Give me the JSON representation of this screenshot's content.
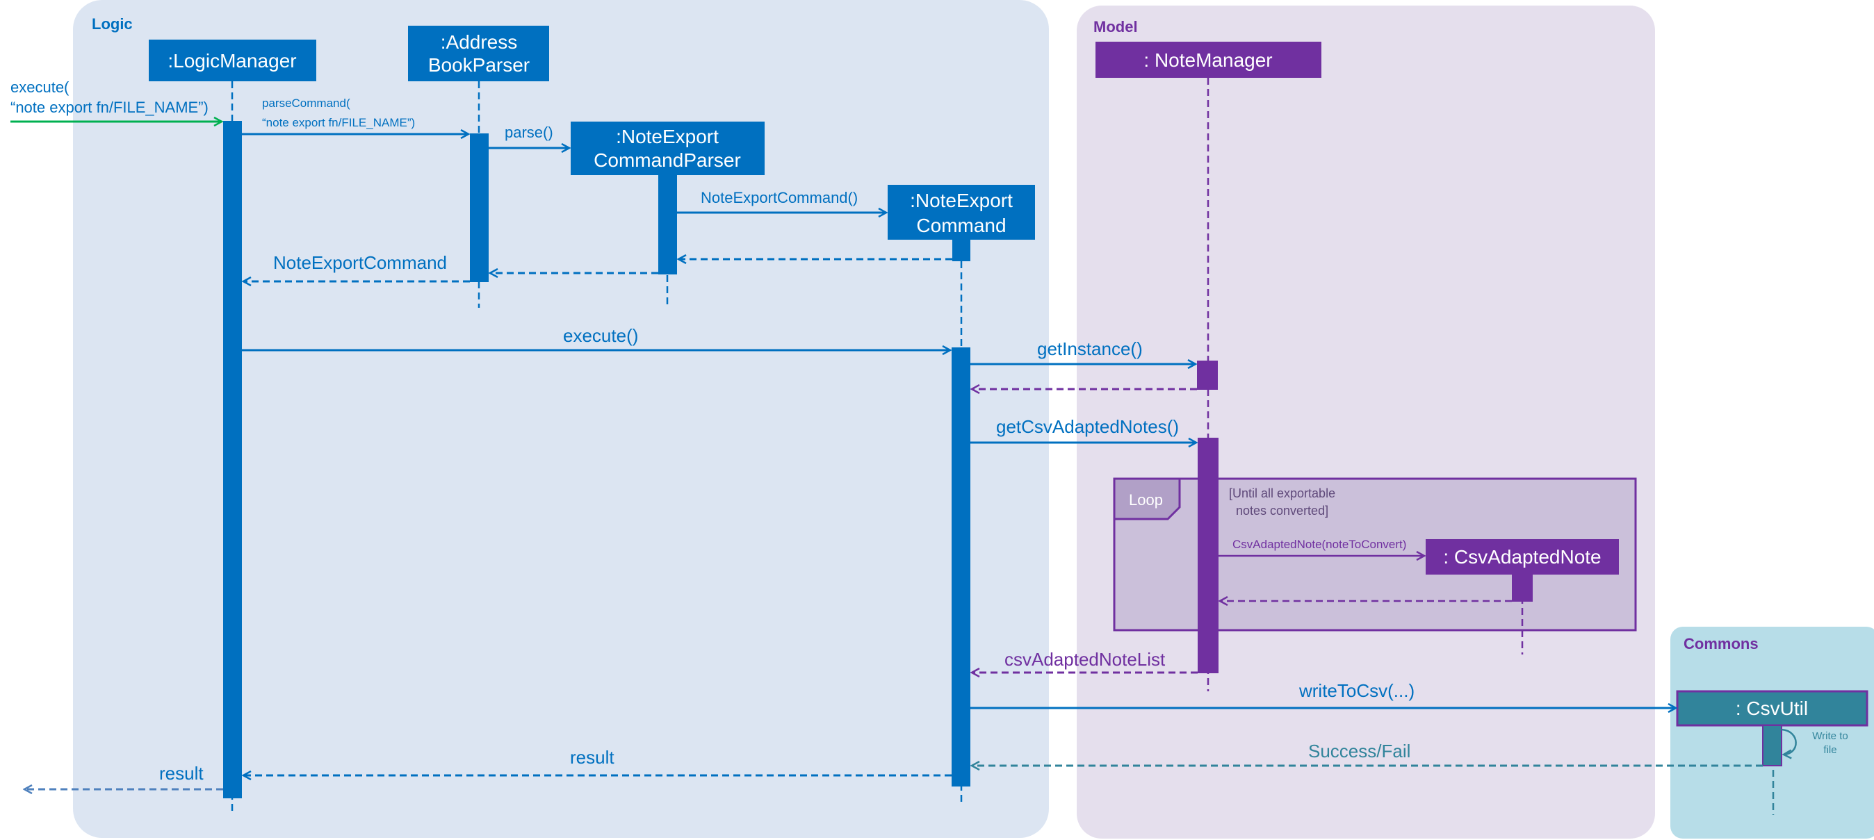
{
  "colors": {
    "logic_bg": "#DCE5F2",
    "model_bg": "#E5DFED",
    "commons_bg": "#B7DDE8",
    "logic_blue": "#0070C0",
    "model_purple": "#7030A0",
    "loop_fill": "#CBC0DA",
    "loop_tab": "#B1A0C7",
    "commons_teal": "#31849B",
    "commons_label": "#7030A0",
    "external_green": "#00B050",
    "final_return": "#4F81BD"
  },
  "packages": {
    "logic": "Logic",
    "model": "Model",
    "commons": "Commons"
  },
  "participants": {
    "logic_manager": ":LogicManager",
    "address_book_parser": [
      ":Address",
      "BookParser"
    ],
    "note_export_command_parser": [
      ":NoteExport",
      "CommandParser"
    ],
    "note_export_command": [
      ":NoteExport",
      "Command"
    ],
    "note_manager": ": NoteManager",
    "csv_adapted_note": ": CsvAdaptedNote",
    "csv_util": ": CsvUtil"
  },
  "messages": {
    "execute_external": [
      "execute(",
      "“note export fn/FILE_NAME”)"
    ],
    "parse_command": [
      "parseCommand(",
      "“note export fn/FILE_NAME”)"
    ],
    "parse": "parse()",
    "note_export_command_ctor": "NoteExportCommand()",
    "note_export_command_return": "NoteExportCommand",
    "execute": "execute()",
    "get_instance": "getInstance()",
    "get_csv_adapted_notes": "getCsvAdaptedNotes()",
    "csv_adapted_note_ctor": "CsvAdaptedNote(noteToConvert)",
    "csv_adapted_note_list": "csvAdaptedNoteList",
    "write_to_csv": "writeToCsv(...)",
    "success_fail": "Success/Fail",
    "result_inner": "result",
    "result_outer": "result",
    "write_to_file": [
      "Write to",
      "file"
    ]
  },
  "loop": {
    "label": "Loop",
    "guard": [
      "[Until all exportable",
      "notes converted]"
    ]
  }
}
